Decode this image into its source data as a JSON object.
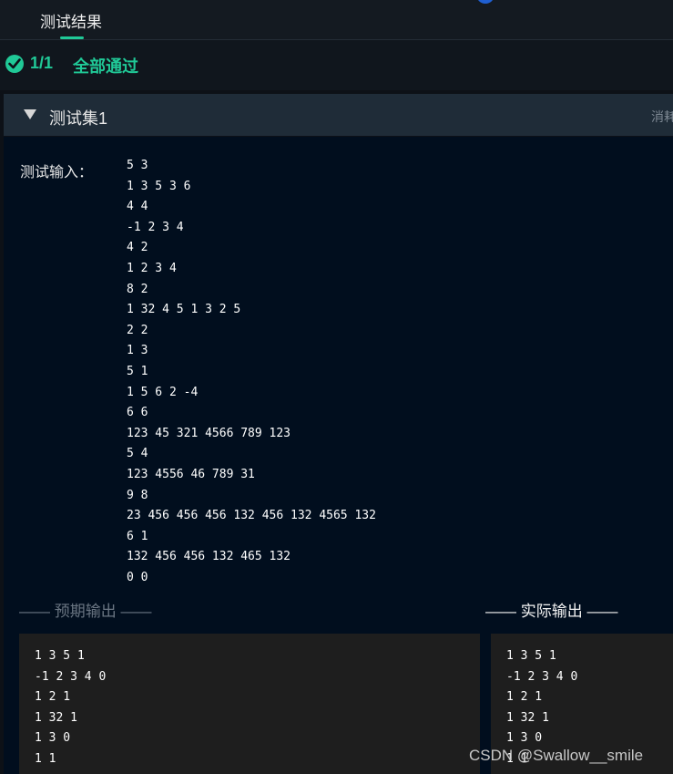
{
  "tabs": {
    "active_label": "测试结果"
  },
  "status": {
    "count": "1/1",
    "text": "全部通过"
  },
  "test_set": {
    "title": "测试集1",
    "meta": "消耗"
  },
  "input": {
    "label": "测试输入：",
    "lines": [
      "5 3",
      "1 3 5 3 6",
      "4 4",
      "-1 2 3 4",
      "4 2",
      "1 2 3 4",
      "8 2",
      "1 32 4 5 1 3 2 5",
      "2 2",
      "1 3",
      "5 1",
      "1 5 6 2 -4",
      "6 6",
      "123 45 321 4566 789 123",
      "5 4",
      "123 4556 46 789 31",
      "9 8",
      "23 456 456 456 132 456 132 4565 132",
      "6 1",
      "132 456 456 132 465 132",
      "0 0"
    ]
  },
  "expected_output": {
    "heading": "—— 预期输出 ——",
    "lines": [
      "1 3 5 1",
      "-1 2 3 4 0",
      "1 2 1",
      "1 32 1",
      "1 3 0",
      "1 1"
    ]
  },
  "actual_output": {
    "heading": "—— 实际输出 ——",
    "lines": [
      "1 3 5 1",
      "-1 2 3 4 0",
      "1 2 1",
      "1 32 1",
      "1 3 0",
      "1 1"
    ]
  },
  "watermark": "CSDN @Swallow__smile",
  "colors": {
    "accent": "#20c997",
    "panel_bg": "#010e1e",
    "header_bg": "#1f2c38"
  }
}
